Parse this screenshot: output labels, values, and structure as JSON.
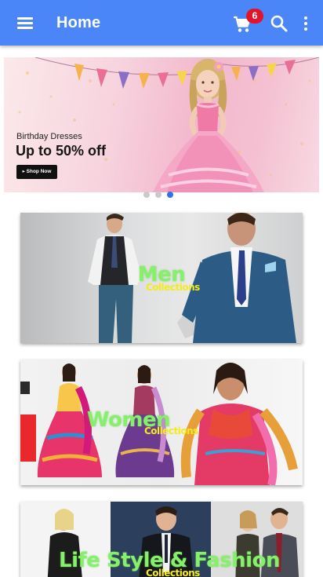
{
  "appbar": {
    "title": "Home",
    "cart_count": "6",
    "icons": [
      "menu-icon",
      "cart-icon",
      "search-icon",
      "more-vert-icon"
    ],
    "color": "#4a86f7",
    "badge_color": "#e0152b"
  },
  "banner": {
    "subtitle": "Birthday Dresses",
    "headline": "Up to 50% off",
    "button": "Shop Now",
    "slides": 3,
    "active_slide": 3
  },
  "categories": [
    {
      "title": "Men",
      "subtitle": "Collections"
    },
    {
      "title": "Women",
      "subtitle": "Collections"
    },
    {
      "title": "Life Style & Fashion",
      "subtitle": "Collections"
    }
  ],
  "colors": {
    "category_title": "#86f06d",
    "category_subtitle": "#f4ec1a",
    "active_indicator": "#2f73e8"
  }
}
